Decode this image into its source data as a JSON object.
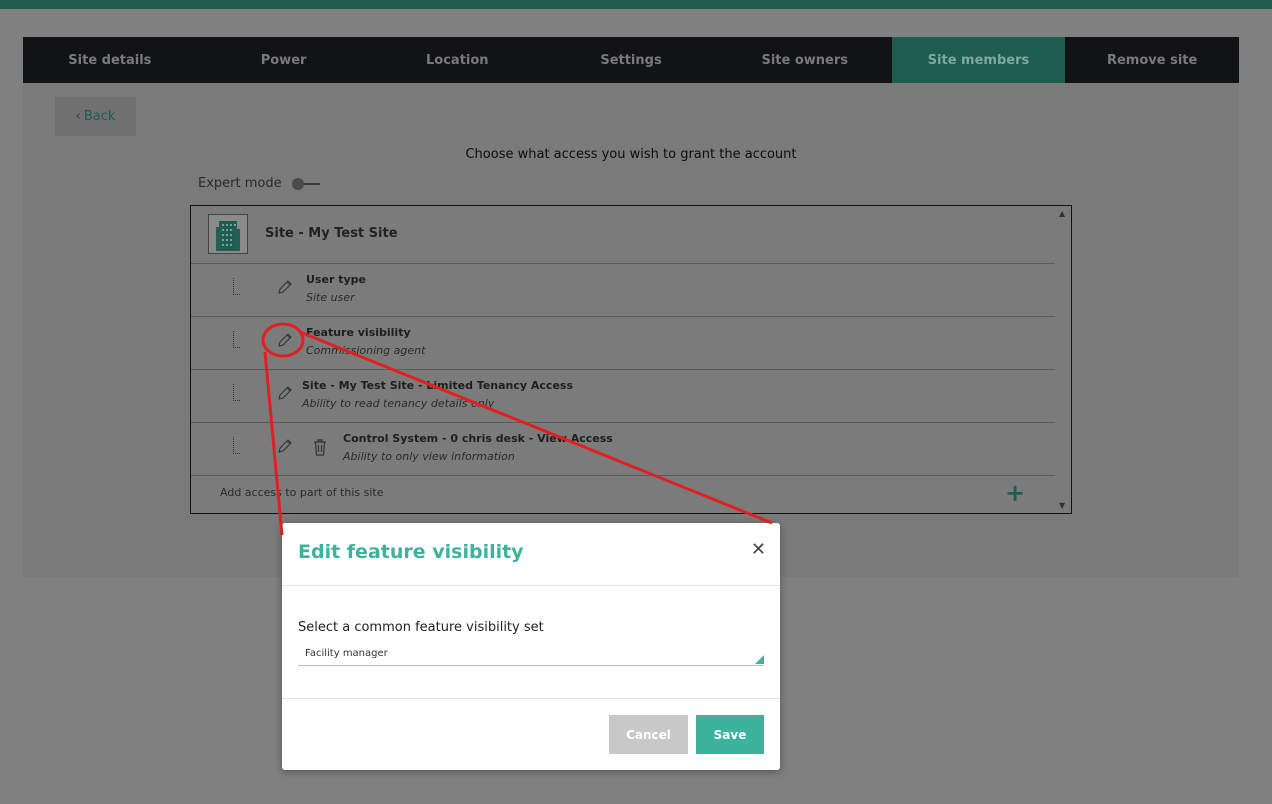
{
  "tabs": [
    {
      "label": "Site details"
    },
    {
      "label": "Power"
    },
    {
      "label": "Location"
    },
    {
      "label": "Settings"
    },
    {
      "label": "Site owners"
    },
    {
      "label": "Site members"
    },
    {
      "label": "Remove site"
    }
  ],
  "active_tab": "Site members",
  "back_label": "Back",
  "prompt": "Choose what access you wish to grant the account",
  "expert_mode": {
    "label": "Expert mode",
    "enabled": false
  },
  "tree": {
    "site_title": "Site - My Test Site",
    "rows": [
      {
        "title": "User type",
        "subtitle": "Site user"
      },
      {
        "title": "Feature visibility",
        "subtitle": "Commissioning agent"
      },
      {
        "title": "Site - My Test Site - Limited Tenancy Access",
        "subtitle": "Ability to read tenancy details only"
      },
      {
        "title": "Control System - 0 chris desk - View Access",
        "subtitle": "Ability to only view information"
      }
    ],
    "add_label": "Add access to part of this site",
    "add_icon": "plus-icon"
  },
  "modal": {
    "title": "Edit feature visibility",
    "close_icon": "close-icon",
    "select_label": "Select a common feature visibility set",
    "select_value": "Facility manager",
    "cancel_label": "Cancel",
    "save_label": "Save"
  },
  "colors": {
    "accent": "#3db39e",
    "annotation": "#e02020"
  }
}
